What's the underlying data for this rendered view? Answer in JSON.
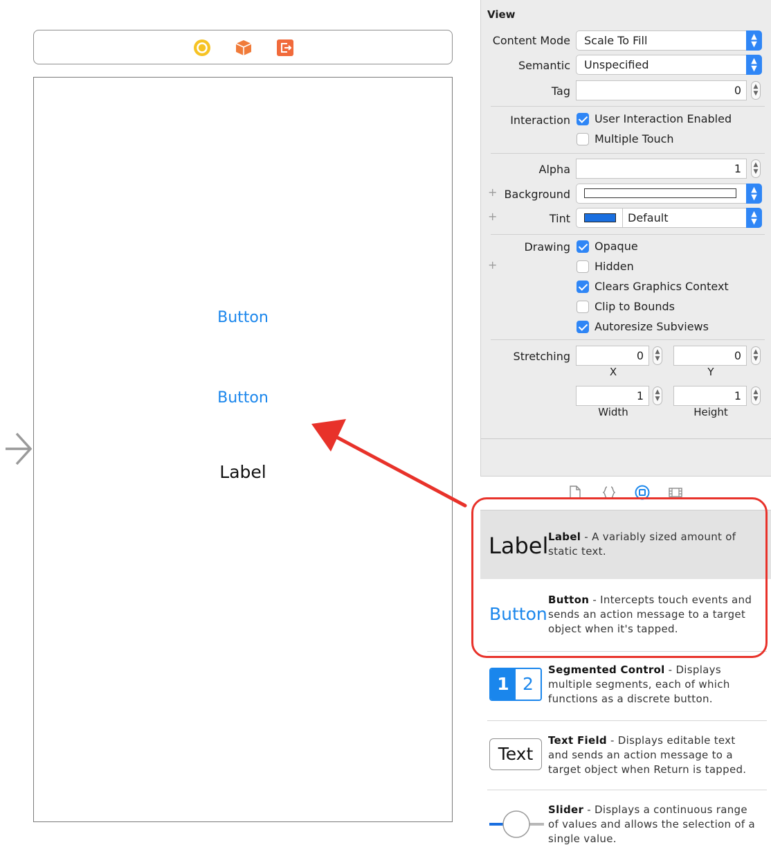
{
  "canvas": {
    "button_1": "Button",
    "button_2": "Button",
    "label": "Label"
  },
  "inspector": {
    "section_title": "View",
    "content_mode": {
      "label": "Content Mode",
      "value": "Scale To Fill"
    },
    "semantic": {
      "label": "Semantic",
      "value": "Unspecified"
    },
    "tag": {
      "label": "Tag",
      "value": "0"
    },
    "interaction": {
      "label": "Interaction",
      "user_interaction_enabled": {
        "label": "User Interaction Enabled",
        "checked": true
      },
      "multiple_touch": {
        "label": "Multiple Touch",
        "checked": false
      }
    },
    "alpha": {
      "label": "Alpha",
      "value": "1"
    },
    "background": {
      "label": "Background",
      "color": "#ffffff"
    },
    "tint": {
      "label": "Tint",
      "value": "Default",
      "color": "#1a86ec"
    },
    "drawing": {
      "label": "Drawing",
      "opaque": {
        "label": "Opaque",
        "checked": true
      },
      "hidden": {
        "label": "Hidden",
        "checked": false
      },
      "clears_graphics_context": {
        "label": "Clears Graphics Context",
        "checked": true
      },
      "clip_to_bounds": {
        "label": "Clip to Bounds",
        "checked": false
      },
      "autoresize_subviews": {
        "label": "Autoresize Subviews",
        "checked": true
      }
    },
    "stretching": {
      "label": "Stretching",
      "x": {
        "label": "X",
        "value": "0"
      },
      "y": {
        "label": "Y",
        "value": "0"
      },
      "width": {
        "label": "Width",
        "value": "1"
      },
      "height": {
        "label": "Height",
        "value": "1"
      }
    }
  },
  "library": {
    "items": [
      {
        "preview": "Label",
        "name": "Label",
        "description": " - A variably sized amount of static text."
      },
      {
        "preview": "Button",
        "name": "Button",
        "description": " - Intercepts touch events and sends an action message to a target object when it's tapped."
      },
      {
        "preview_segments": [
          "1",
          "2"
        ],
        "name": "Segmented Control",
        "description": " - Displays multiple segments, each of which functions as a discrete button."
      },
      {
        "preview": "Text",
        "name": "Text Field",
        "description": " - Displays editable text and sends an action message to a target object when Return is tapped."
      },
      {
        "name": "Slider",
        "description": " - Displays a continuous range of values and allows the selection of a single value."
      }
    ]
  },
  "colors": {
    "accent": "#1a86ec",
    "annotation": "#e8322a",
    "checkbox": "#2f86f6"
  },
  "icons": {
    "scene_dock": [
      "view-controller-icon",
      "first-responder-icon",
      "exit-icon"
    ],
    "library_tabs": [
      "file-icon",
      "braces-icon",
      "object-icon",
      "media-icon"
    ]
  }
}
